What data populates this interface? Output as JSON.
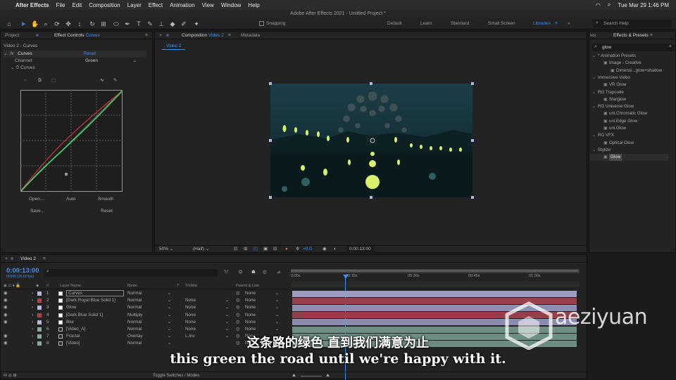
{
  "menubar": {
    "app": "After Effects",
    "items": [
      "File",
      "Edit",
      "Composition",
      "Layer",
      "Effect",
      "Animation",
      "View",
      "Window",
      "Help"
    ],
    "clock": "Tue Mar 29  1:46 PM"
  },
  "window_title": "Adobe After Effects 2021 - Untitled Project *",
  "toolbar": {
    "snapping": "Snapping",
    "workspaces": [
      "Default",
      "Learn",
      "Standard",
      "Small Screen",
      "Libraries"
    ],
    "search_help": "Search Help"
  },
  "left_panel": {
    "tab_project": "Project",
    "tab_effect_controls": "Effect Controls",
    "tab_effect_controls_target": "Curves",
    "layer_path": "Video 2 - Curves",
    "fx_label": "fx",
    "effect_name": "Curves",
    "reset": "Reset",
    "channel_label": "Channel:",
    "channel_value": "Green",
    "curves_label": "Curves",
    "btn_open": "Open...",
    "btn_auto": "Auto",
    "btn_smooth": "Smooth",
    "btn_save": "Save...",
    "btn_reset": "Reset"
  },
  "comp_panel": {
    "tab_label": "Composition",
    "tab_target": "Video 2",
    "tab_metadata": "Metadata",
    "comp_tab": "Video 2",
    "zoom": "50%",
    "resolution": "(Half)",
    "exposure": "+0.0",
    "timecode": "0:00:13:00"
  },
  "effects_panel": {
    "title": "Effects & Presets",
    "search_value": "glow",
    "tree": [
      {
        "label": "* Animation Presets",
        "level": 0
      },
      {
        "label": "Image - Creative",
        "level": 1
      },
      {
        "label": "Dimensi...glow+shadow",
        "level": 2
      },
      {
        "label": "Immersive Video",
        "level": 0
      },
      {
        "label": "VR Glow",
        "level": 1
      },
      {
        "label": "RG Trapcode",
        "level": 0
      },
      {
        "label": "Starglow",
        "level": 1
      },
      {
        "label": "RG Universe Glow",
        "level": 0
      },
      {
        "label": "uni.Chromatic Glow",
        "level": 1
      },
      {
        "label": "uni.Edge Glow",
        "level": 1
      },
      {
        "label": "uni.Glow",
        "level": 1
      },
      {
        "label": "RG VFX",
        "level": 0
      },
      {
        "label": "Optical Glow",
        "level": 1
      },
      {
        "label": "Stylize",
        "level": 0
      },
      {
        "label": "Glow",
        "level": 1,
        "selected": true
      }
    ]
  },
  "timeline": {
    "tab": "Video 2",
    "timecode": "0:00:13:00",
    "fps": "00300 (30.00 fps)",
    "col_num": "#",
    "col_layer_name": "Layer Name",
    "col_mode": "Mode",
    "col_t": "T",
    "col_trkmat": "TrkMat",
    "col_parent": "Parent & Link",
    "ruler": [
      "0:00s",
      "00:15s",
      "00:30s",
      "00:45s",
      "01:00s"
    ],
    "layers": [
      {
        "num": "1",
        "name": "Curves",
        "mode": "Normal",
        "trkmat": "",
        "parent": "None",
        "color": "#b7b7d8",
        "bar": "#9d9dc4"
      },
      {
        "num": "2",
        "name": "[Dark Royal Blue Solid 1]",
        "mode": "Normal",
        "trkmat": "None",
        "parent": "None",
        "color": "#b0414a",
        "bar": "#97424c"
      },
      {
        "num": "3",
        "name": "Glow",
        "mode": "Normal",
        "trkmat": "None",
        "parent": "None",
        "color": "#b7b7d8",
        "bar": "#8f8fb4"
      },
      {
        "num": "4",
        "name": "[Dark Blue Solid 1]",
        "mode": "Multiply",
        "trkmat": "None",
        "parent": "None",
        "color": "#b0414a",
        "bar": "#94414b"
      },
      {
        "num": "5",
        "name": "Blur",
        "mode": "Normal",
        "trkmat": "None",
        "parent": "None",
        "color": "#b7b7d8",
        "bar": "#8c8cb0"
      },
      {
        "num": "6",
        "name": "[Video_A]",
        "mode": "Normal",
        "trkmat": "None",
        "parent": "None",
        "color": "#8fa8a0",
        "bar": "#6f8f86"
      },
      {
        "num": "7",
        "name": "Fractal",
        "mode": "Overlay",
        "trkmat": "L.Inv",
        "parent": "None",
        "color": "#8fa8a0",
        "bar": "#6e8e83"
      },
      {
        "num": "8",
        "name": "[Video]",
        "mode": "Normal",
        "trkmat": "",
        "parent": "None",
        "color": "#8fa8a0",
        "bar": "#6d8c82"
      }
    ],
    "toggle": "Toggle Switches / Modes"
  },
  "subtitles": {
    "zh": "这条路的绿色 直到我们满意为止",
    "en": "this green the road until we're happy with it."
  },
  "watermark": {
    "name": "aeziyuan",
    ".com": ".com"
  }
}
